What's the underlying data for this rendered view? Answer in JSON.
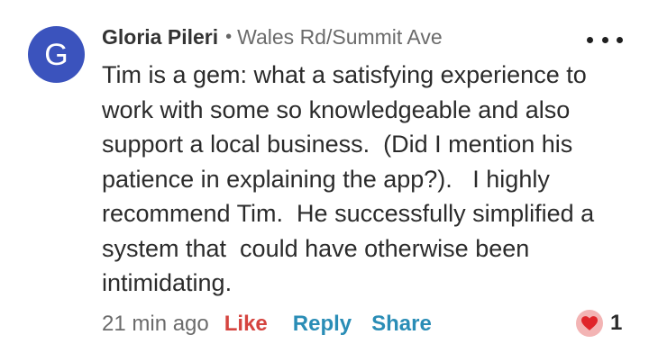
{
  "comment": {
    "avatar_initial": "G",
    "author": "Gloria Pileri",
    "separator": "•",
    "location": "Wales Rd/Summit Ave",
    "more_icon": "more-horizontal-icon",
    "lines": [
      "Tim is a gem: what a satisfying experience to",
      "work with some so knowledgeable and also",
      "support a local business.  (Did I mention his",
      "patience in explaining the app?).   I highly",
      "recommend Tim.  He successfully simplified a",
      "system that  could have otherwise been",
      "intimidating."
    ],
    "timestamp": "21 min ago",
    "like_label": "Like",
    "reply_label": "Reply",
    "share_label": "Share",
    "reaction_icon": "heart-icon",
    "reaction_count": "1"
  },
  "colors": {
    "avatar": "#3b53bd",
    "like": "#d5443f",
    "reply": "#2a8db6",
    "share": "#2a8db6",
    "heart": "#e0252a",
    "heart_badge": "#f3b4b4"
  }
}
